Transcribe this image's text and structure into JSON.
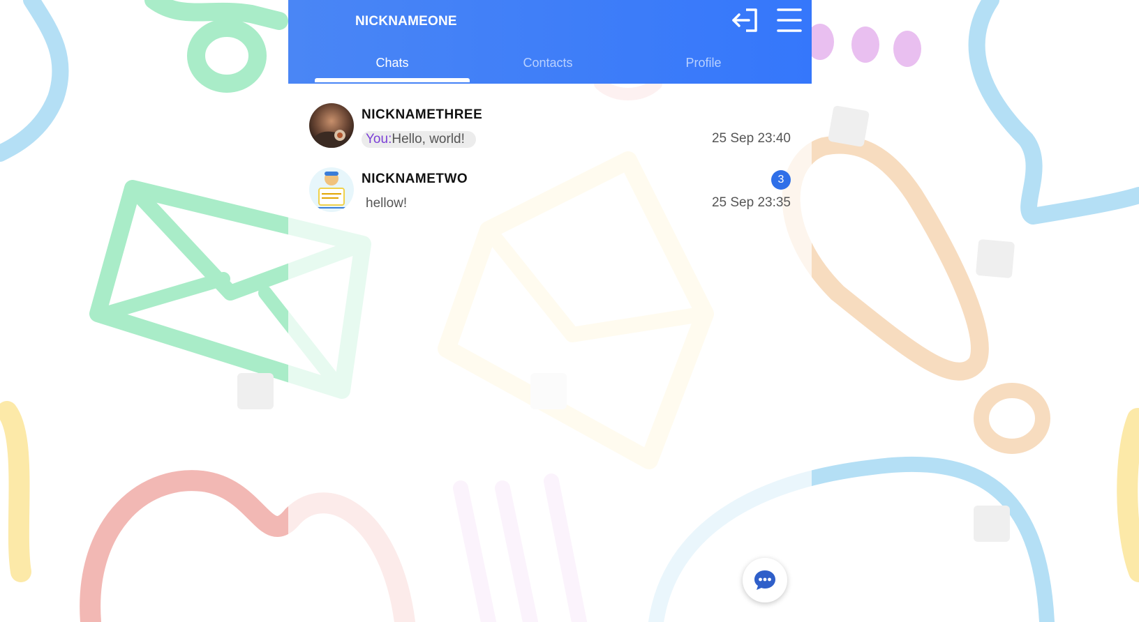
{
  "app": {
    "title": "NICKNAMEONE"
  },
  "header": {
    "logout_icon": "logout-icon",
    "menu_icon": "hamburger-menu-icon"
  },
  "tabs": [
    {
      "label": "Chats",
      "active": true
    },
    {
      "label": "Contacts",
      "active": false
    },
    {
      "label": "Profile",
      "active": false
    }
  ],
  "chats": [
    {
      "name": "NICKNAMETHREE",
      "sender_prefix": "You:",
      "message": "Hello, world!",
      "time": "25 Sep 23:40",
      "unread": null
    },
    {
      "name": "NICKNAMETWO",
      "sender_prefix": "",
      "message": "hellow!",
      "time": "25 Sep 23:35",
      "unread": "3"
    }
  ],
  "fab": {
    "icon": "chat-bubble-icon"
  },
  "colors": {
    "header_start": "#4a86f5",
    "header_end": "#3577fb",
    "badge": "#2f6fe8",
    "you_prefix": "#7b3fd6"
  }
}
